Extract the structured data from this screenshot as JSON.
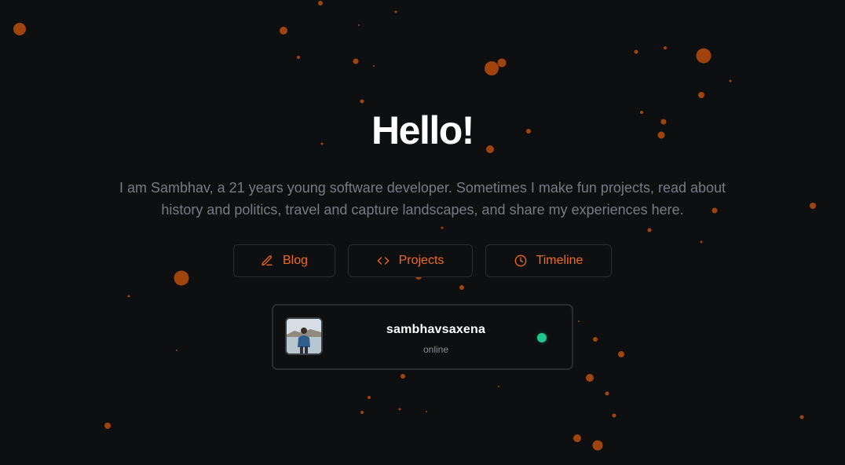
{
  "hero": {
    "title": "Hello!",
    "intro": "I am Sambhav, a 21 years young software developer. Sometimes I make fun projects, read about history and politics, travel and capture landscapes, and share my experiences here."
  },
  "nav": {
    "blog_label": "Blog",
    "projects_label": "Projects",
    "timeline_label": "Timeline"
  },
  "profile": {
    "username": "sambhavsaxena",
    "status": "online",
    "status_color": "#22c58c"
  },
  "colors": {
    "background": "#0e0f11",
    "accent": "#f26a1b",
    "particle": "#a0440e",
    "border": "#2a2c30"
  },
  "icons": {
    "blog": "pencil-icon",
    "projects": "code-icon",
    "timeline": "clock-icon",
    "status": "status-dot"
  }
}
